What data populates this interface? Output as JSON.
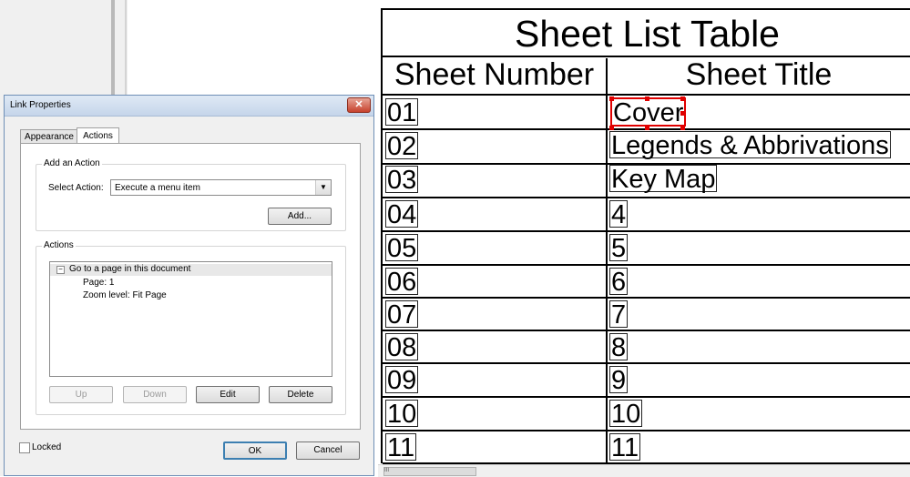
{
  "dialog": {
    "title": "Link Properties",
    "close_glyph": "✕",
    "tabs": [
      {
        "label": "Appearance",
        "selected": false
      },
      {
        "label": "Actions",
        "selected": true
      }
    ],
    "add_action_group": {
      "legend": "Add an Action",
      "select_label": "Select Action:",
      "select_value": "Execute a menu item",
      "add_button": "Add..."
    },
    "actions_group": {
      "legend": "Actions",
      "tree": {
        "root": "Go to a page in this document",
        "children": [
          "Page: 1",
          "Zoom level: Fit Page"
        ]
      },
      "buttons": {
        "up": "Up",
        "down": "Down",
        "edit": "Edit",
        "delete": "Delete"
      }
    },
    "locked_label": "Locked",
    "ok_button": "OK",
    "cancel_button": "Cancel"
  },
  "sheet_table": {
    "title": "Sheet List Table",
    "headers": [
      "Sheet Number",
      "Sheet Title"
    ],
    "rows": [
      {
        "number": "01",
        "title": "Cover"
      },
      {
        "number": "02",
        "title": "Legends & Abbrivations"
      },
      {
        "number": "03",
        "title": "Key Map"
      },
      {
        "number": "04",
        "title": "4"
      },
      {
        "number": "05",
        "title": "5"
      },
      {
        "number": "06",
        "title": "6"
      },
      {
        "number": "07",
        "title": "7"
      },
      {
        "number": "08",
        "title": "8"
      },
      {
        "number": "09",
        "title": "9"
      },
      {
        "number": "10",
        "title": "10"
      },
      {
        "number": "11",
        "title": "11"
      }
    ]
  },
  "scrollbar": {
    "grip": "III"
  },
  "colors": {
    "selection": "#e00000",
    "dialog_border": "#6f8fb6"
  }
}
